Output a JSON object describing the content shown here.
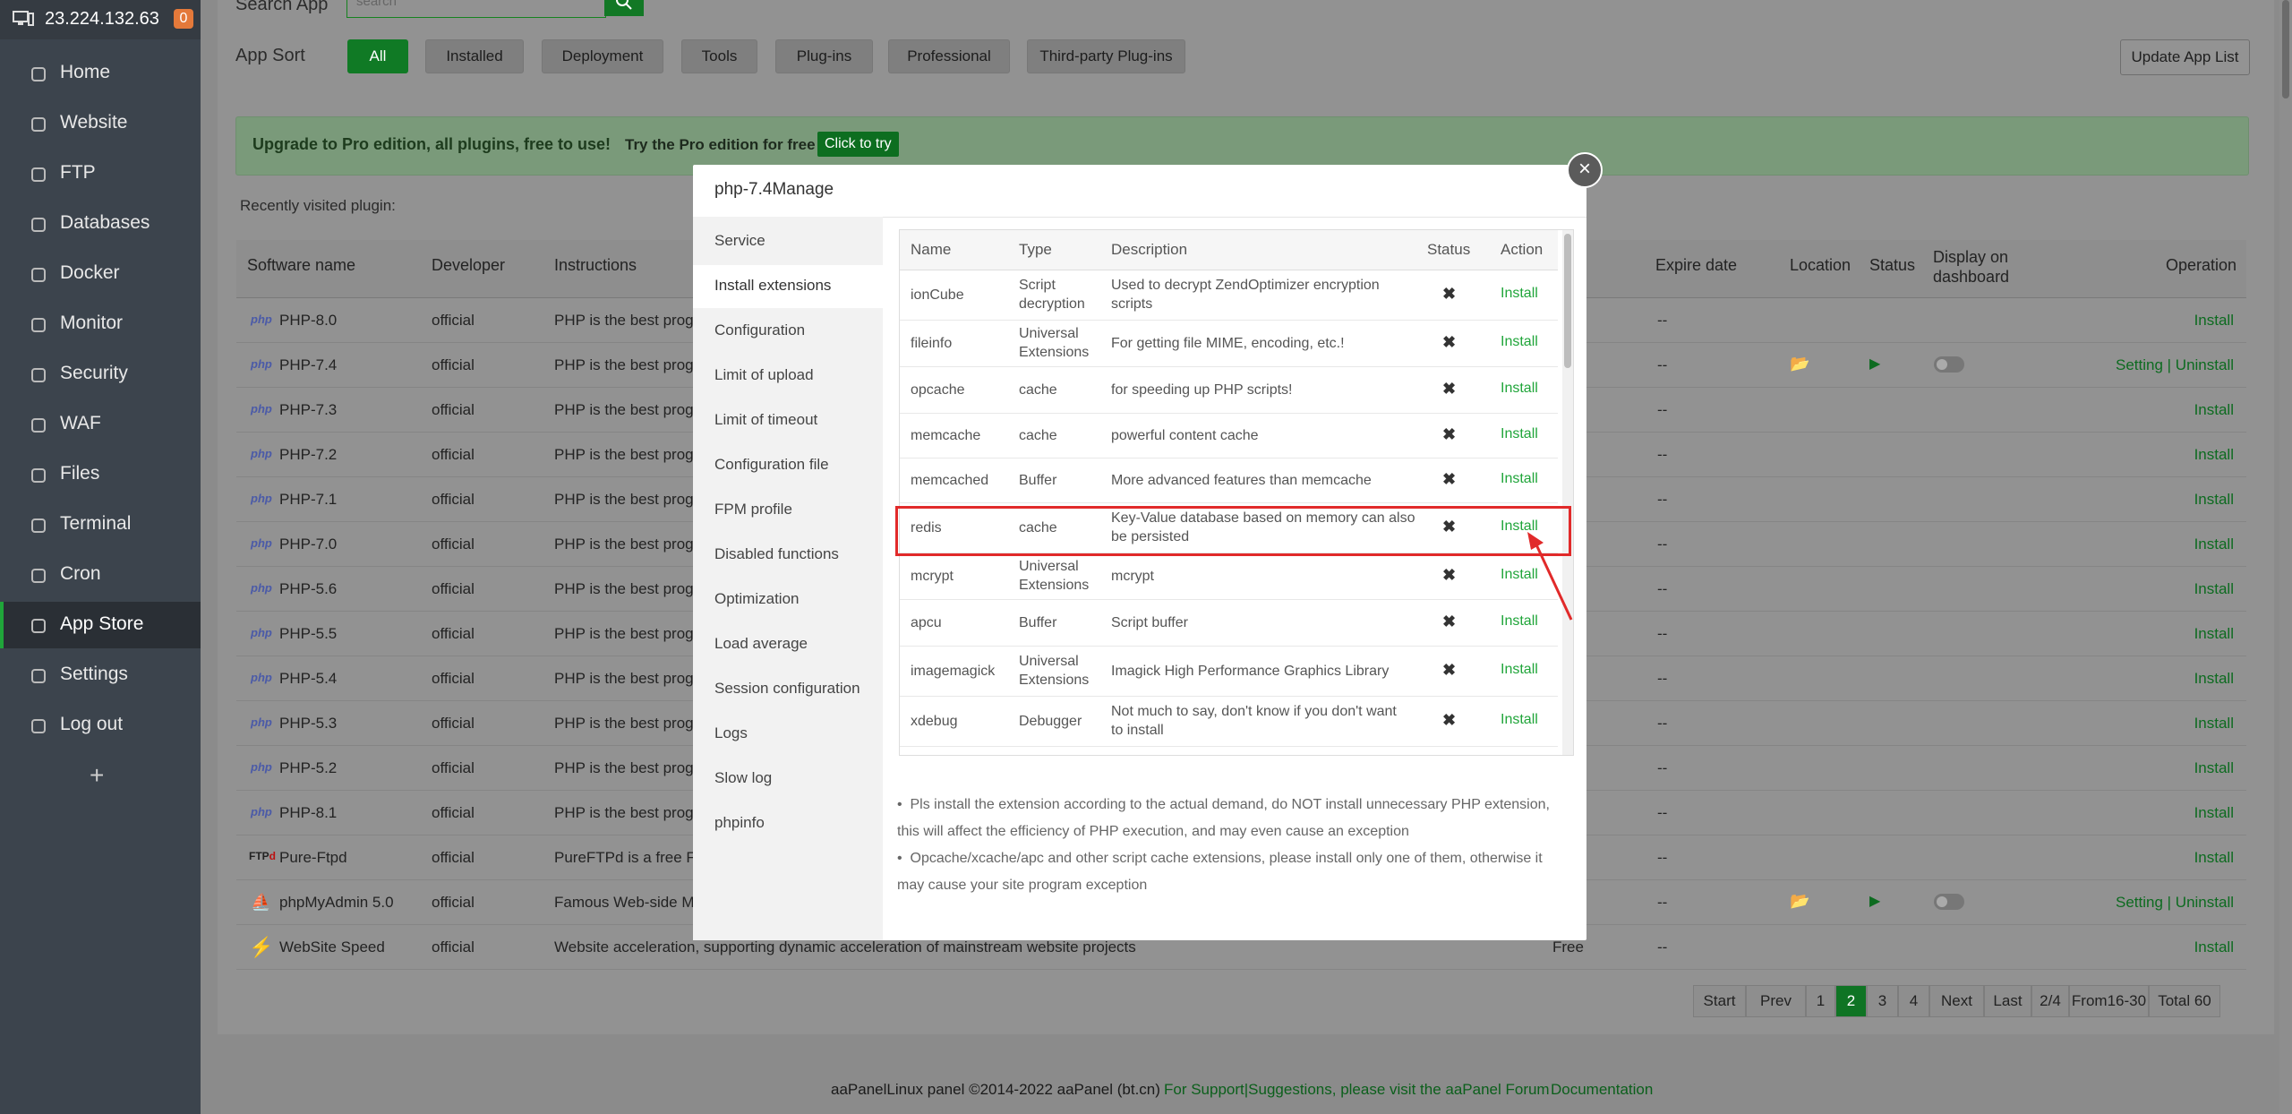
{
  "sidebar": {
    "server_ip": "23.224.132.63",
    "badge": "0",
    "items": [
      {
        "label": "Home",
        "icon": "home-icon"
      },
      {
        "label": "Website",
        "icon": "globe-icon"
      },
      {
        "label": "FTP",
        "icon": "ftp-icon"
      },
      {
        "label": "Databases",
        "icon": "database-icon"
      },
      {
        "label": "Docker",
        "icon": "docker-icon"
      },
      {
        "label": "Monitor",
        "icon": "monitor-icon"
      },
      {
        "label": "Security",
        "icon": "shield-icon"
      },
      {
        "label": "WAF",
        "icon": "waf-shield-icon"
      },
      {
        "label": "Files",
        "icon": "folder-icon"
      },
      {
        "label": "Terminal",
        "icon": "terminal-icon"
      },
      {
        "label": "Cron",
        "icon": "clock-icon"
      },
      {
        "label": "App Store",
        "icon": "grid-icon"
      },
      {
        "label": "Settings",
        "icon": "gear-icon"
      },
      {
        "label": "Log out",
        "icon": "logout-icon"
      }
    ],
    "active_item": "App Store",
    "plus": "+"
  },
  "search": {
    "label": "Search App",
    "placeholder": "search"
  },
  "app_sort": {
    "label": "App Sort",
    "tabs": [
      "All",
      "Installed",
      "Deployment",
      "Tools",
      "Plug-ins",
      "Professional",
      "Third-party Plug-ins"
    ],
    "active": "All",
    "update_button": "Update App List"
  },
  "upgrade": {
    "text": "Upgrade to Pro edition, all plugins, free to use!",
    "try_text": "Try the Pro edition for free",
    "button": "Click to try"
  },
  "recent": {
    "label": "Recently visited plugin:"
  },
  "table": {
    "headers": {
      "name": "Software name",
      "developer": "Developer",
      "instructions": "Instructions",
      "expire": "Expire date",
      "location": "Location",
      "status": "Status",
      "display": "Display on dashboard",
      "operation": "Operation"
    },
    "rows": [
      {
        "logo": "php",
        "name": "PHP-8.0",
        "developer": "official",
        "instructions": "PHP is the best progr",
        "price": "",
        "expire": "--",
        "location": false,
        "op": "Install"
      },
      {
        "logo": "php",
        "name": "PHP-7.4",
        "developer": "official",
        "instructions": "PHP is the best progr",
        "price": "",
        "expire": "--",
        "location": true,
        "op": "Setting | Uninstall"
      },
      {
        "logo": "php",
        "name": "PHP-7.3",
        "developer": "official",
        "instructions": "PHP is the best progr",
        "price": "",
        "expire": "--",
        "location": false,
        "op": "Install"
      },
      {
        "logo": "php",
        "name": "PHP-7.2",
        "developer": "official",
        "instructions": "PHP is the best progr",
        "price": "",
        "expire": "--",
        "location": false,
        "op": "Install"
      },
      {
        "logo": "php",
        "name": "PHP-7.1",
        "developer": "official",
        "instructions": "PHP is the best progr",
        "price": "",
        "expire": "--",
        "location": false,
        "op": "Install"
      },
      {
        "logo": "php",
        "name": "PHP-7.0",
        "developer": "official",
        "instructions": "PHP is the best progr",
        "price": "",
        "expire": "--",
        "location": false,
        "op": "Install"
      },
      {
        "logo": "php",
        "name": "PHP-5.6",
        "developer": "official",
        "instructions": "PHP is the best progr",
        "price": "",
        "expire": "--",
        "location": false,
        "op": "Install"
      },
      {
        "logo": "php",
        "name": "PHP-5.5",
        "developer": "official",
        "instructions": "PHP is the best progr",
        "price": "",
        "expire": "--",
        "location": false,
        "op": "Install"
      },
      {
        "logo": "php",
        "name": "PHP-5.4",
        "developer": "official",
        "instructions": "PHP is the best progr",
        "price": "",
        "expire": "--",
        "location": false,
        "op": "Install"
      },
      {
        "logo": "php",
        "name": "PHP-5.3",
        "developer": "official",
        "instructions": "PHP is the best progr",
        "price": "",
        "expire": "--",
        "location": false,
        "op": "Install"
      },
      {
        "logo": "php",
        "name": "PHP-5.2",
        "developer": "official",
        "instructions": "PHP is the best progr",
        "price": "",
        "expire": "--",
        "location": false,
        "op": "Install"
      },
      {
        "logo": "php",
        "name": "PHP-8.1",
        "developer": "official",
        "instructions": "PHP is the best progr",
        "price": "",
        "expire": "--",
        "location": false,
        "op": "Install"
      },
      {
        "logo": "FTPd",
        "name": "Pure-Ftpd",
        "developer": "official",
        "instructions": "PureFTPd is a free FTP",
        "price": "",
        "expire": "--",
        "location": false,
        "op": "Install"
      },
      {
        "logo": "pma",
        "name": "phpMyAdmin 5.0",
        "developer": "official",
        "instructions": "Famous Web-side My",
        "price": "",
        "expire": "--",
        "location": true,
        "op": "Setting | Uninstall"
      },
      {
        "logo": "speed",
        "name": "WebSite Speed",
        "developer": "official",
        "instructions": "Website acceleration, supporting dynamic acceleration of mainstream website projects",
        "price": "Free",
        "expire": "--",
        "location": false,
        "op": "Install"
      }
    ]
  },
  "pager": {
    "items": [
      "Start",
      "Prev",
      "1",
      "2",
      "3",
      "4",
      "Next",
      "Last",
      "2/4",
      "From16-30",
      "Total 60"
    ],
    "current": "2"
  },
  "footer": {
    "copyright": "aaPanelLinux panel ©2014-2022 aaPanel (bt.cn)",
    "support": "For Support|Suggestions, please visit the aaPanel Forum",
    "docs": "Documentation"
  },
  "modal": {
    "title": "php-7.4Manage",
    "menu": [
      "Service",
      "Install extensions",
      "Configuration",
      "Limit of upload",
      "Limit of timeout",
      "Configuration file",
      "FPM profile",
      "Disabled functions",
      "Optimization",
      "Load average",
      "Session configuration",
      "Logs",
      "Slow log",
      "phpinfo"
    ],
    "active_menu": "Install extensions",
    "ext_headers": {
      "name": "Name",
      "type": "Type",
      "description": "Description",
      "status": "Status",
      "action": "Action"
    },
    "extensions": [
      {
        "name": "ionCube",
        "type": [
          "Script",
          "decryption"
        ],
        "description": [
          "Used to decrypt ZendOptimizer encryption",
          "scripts"
        ],
        "status": "✖",
        "action": "Install"
      },
      {
        "name": "fileinfo",
        "type": [
          "Universal",
          "Extensions"
        ],
        "description": [
          "For getting file MIME, encoding, etc.!"
        ],
        "status": "✖",
        "action": "Install"
      },
      {
        "name": "opcache",
        "type": [
          "cache"
        ],
        "description": [
          "for speeding up PHP scripts!"
        ],
        "status": "✖",
        "action": "Install"
      },
      {
        "name": "memcache",
        "type": [
          "cache"
        ],
        "description": [
          "powerful content cache"
        ],
        "status": "✖",
        "action": "Install"
      },
      {
        "name": "memcached",
        "type": [
          "Buffer"
        ],
        "description": [
          "More advanced features than memcache"
        ],
        "status": "✖",
        "action": "Install"
      },
      {
        "name": "redis",
        "type": [
          "cache"
        ],
        "description": [
          "Key-Value database based on memory can also",
          "be persisted"
        ],
        "status": "✖",
        "action": "Install"
      },
      {
        "name": "mcrypt",
        "type": [
          "Universal",
          "Extensions"
        ],
        "description": [
          "mcrypt"
        ],
        "status": "✖",
        "action": "Install"
      },
      {
        "name": "apcu",
        "type": [
          "Buffer"
        ],
        "description": [
          "Script buffer"
        ],
        "status": "✖",
        "action": "Install"
      },
      {
        "name": "imagemagick",
        "type": [
          "Universal",
          "Extensions"
        ],
        "description": [
          "Imagick High Performance Graphics Library"
        ],
        "status": "✖",
        "action": "Install"
      },
      {
        "name": "xdebug",
        "type": [
          "Debugger"
        ],
        "description": [
          "Not much to say, don't know if you don't want",
          "to install"
        ],
        "status": "✖",
        "action": "Install"
      }
    ],
    "highlighted": "redis",
    "notes": [
      "Pls install the extension according to the actual demand, do NOT install unnecessary PHP extension, this will affect the efficiency of PHP execution, and may even cause an exception",
      "Opcache/xcache/apc and other script cache extensions, please install only one of them, otherwise it may cause your site program exception"
    ],
    "close": "×"
  },
  "colors": {
    "accent": "#20a53a",
    "highlight": "#e12a2a",
    "sidebar": "#3c444d"
  }
}
